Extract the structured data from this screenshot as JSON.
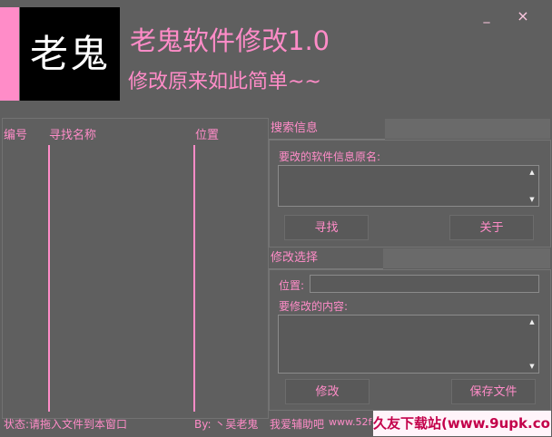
{
  "header": {
    "logo_text": "老鬼",
    "title": "老鬼软件修改1.0",
    "subtitle": "修改原来如此简单~~",
    "minimize_symbol": "_",
    "close_symbol": "×"
  },
  "list": {
    "columns": [
      "编号",
      "寻找名称",
      "位置"
    ]
  },
  "search_group": {
    "title": "搜索信息",
    "field_label": "要改的软件信息原名:",
    "field_value": "",
    "find_button": "寻找",
    "about_button": "关于"
  },
  "modify_group": {
    "title": "修改选择",
    "position_label": "位置:",
    "position_value": "",
    "content_label": "要修改的内容:",
    "content_value": "",
    "modify_button": "修改",
    "save_button": "保存文件"
  },
  "status_bar": {
    "status_text": "状态:请拖入文件到本窗口",
    "author_text": "By: 丶吴老鬼",
    "helper_text": "我爱辅助吧",
    "site_text": "www.52f"
  },
  "watermark": "久友下载站(www.9upk.com)",
  "colors": {
    "background": "#5f5f5f",
    "accent_pink": "#ff8cc8",
    "logo_bg": "#000000"
  }
}
